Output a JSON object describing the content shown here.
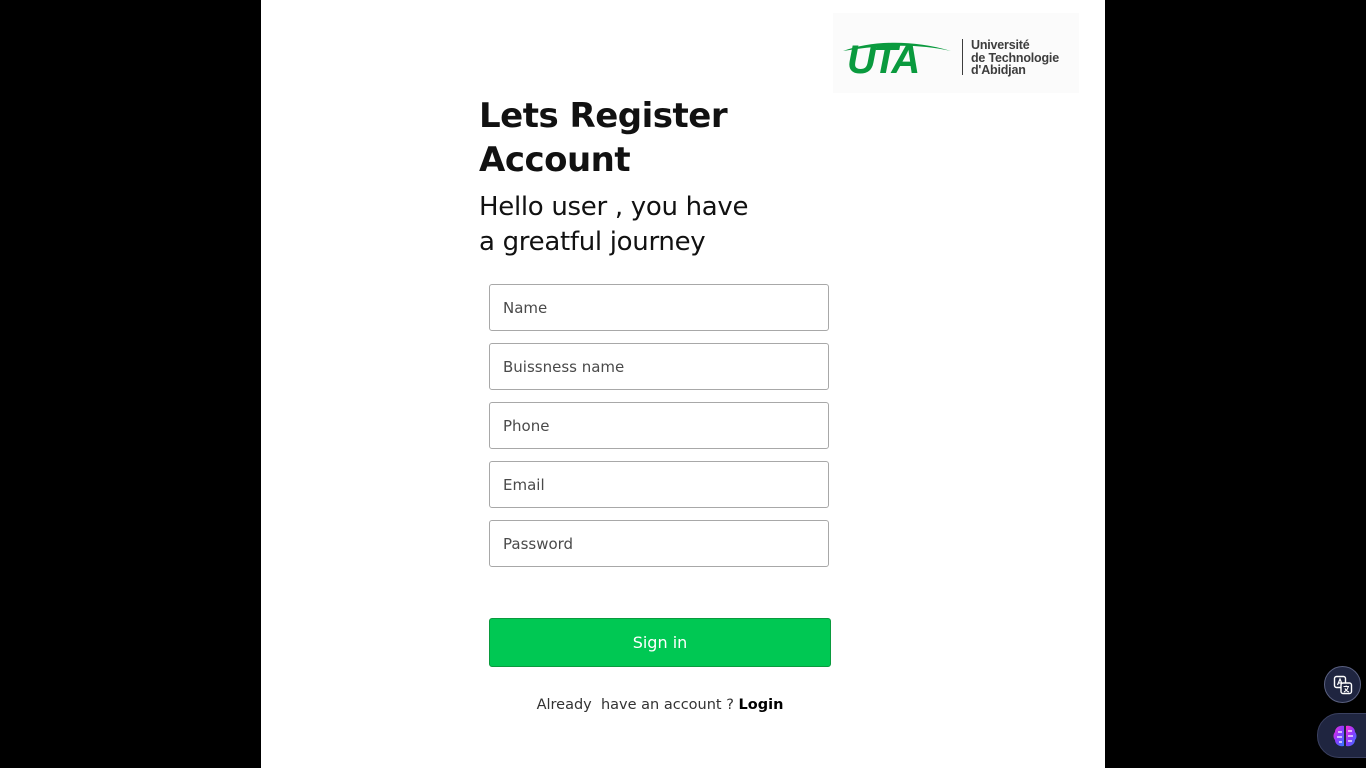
{
  "logo": {
    "mark": "UTA",
    "line1": "Université",
    "line2": "de Technologie",
    "line3": "d'Abidjan"
  },
  "heading": {
    "line1": "Lets Register",
    "line2": "Account"
  },
  "subheading": {
    "line1": "Hello user , you have",
    "line2": "a greatful journey"
  },
  "form": {
    "name_placeholder": "Name",
    "business_placeholder": "Buissness name",
    "phone_placeholder": "Phone",
    "email_placeholder": "Email",
    "password_placeholder": "Password",
    "submit_label": "Sign in"
  },
  "footer": {
    "prompt": "Already  have an account ? ",
    "login_label": "Login"
  },
  "floating": {
    "translate_icon": "translate-icon",
    "assistant_icon": "brain-icon"
  },
  "colors": {
    "accent": "#00c853",
    "logo_green": "#0a9a3e",
    "background": "#000000"
  }
}
